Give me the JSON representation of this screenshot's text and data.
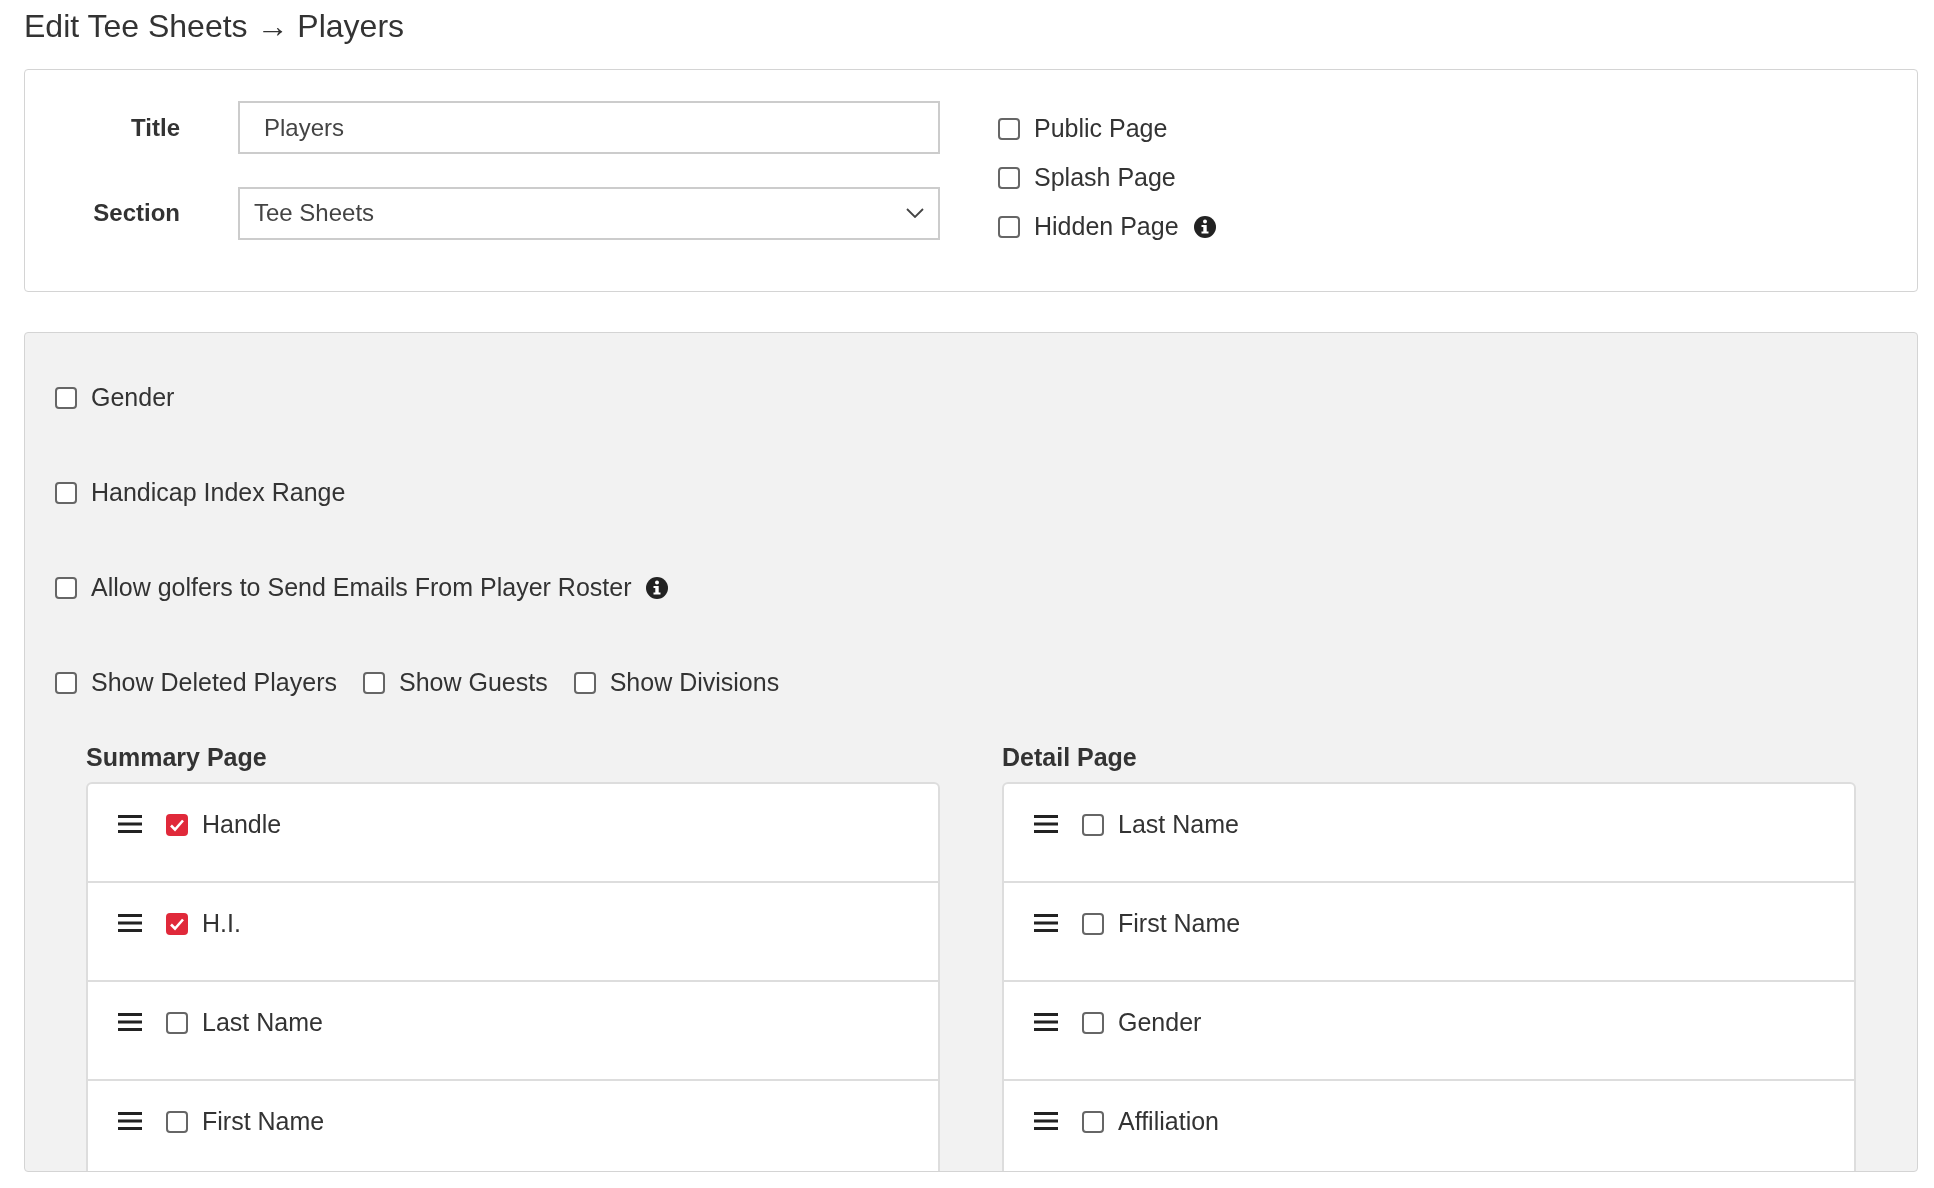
{
  "heading": "Edit Tee Sheets → Players",
  "page_settings": {
    "fields": [
      {
        "label": "Title",
        "kind": "text",
        "value": "Players"
      },
      {
        "label": "Section",
        "kind": "select",
        "value": "Tee Sheets"
      }
    ],
    "options": [
      {
        "label": "Public Page",
        "checked": false,
        "info": false
      },
      {
        "label": "Splash Page",
        "checked": false,
        "info": false
      },
      {
        "label": "Hidden Page",
        "checked": false,
        "info": true
      }
    ]
  },
  "option_rows": [
    {
      "items": [
        {
          "label": "Gender",
          "checked": false,
          "info": false
        }
      ]
    },
    {
      "items": [
        {
          "label": "Handicap Index Range",
          "checked": false,
          "info": false
        }
      ]
    },
    {
      "items": [
        {
          "label": "Allow golfers to Send Emails From Player Roster",
          "checked": false,
          "info": true
        }
      ]
    },
    {
      "items": [
        {
          "label": "Show Deleted Players",
          "checked": false,
          "info": false
        },
        {
          "label": "Show Guests",
          "checked": false,
          "info": false
        },
        {
          "label": "Show Divisions",
          "checked": false,
          "info": false
        }
      ]
    }
  ],
  "columns": [
    {
      "title": "Summary Page",
      "items": [
        {
          "label": "Handle",
          "checked": true
        },
        {
          "label": "H.I.",
          "checked": true
        },
        {
          "label": "Last Name",
          "checked": false
        },
        {
          "label": "First Name",
          "checked": false
        }
      ]
    },
    {
      "title": "Detail Page",
      "items": [
        {
          "label": "Last Name",
          "checked": false
        },
        {
          "label": "First Name",
          "checked": false
        },
        {
          "label": "Gender",
          "checked": false
        },
        {
          "label": "Affiliation",
          "checked": false
        }
      ]
    }
  ]
}
